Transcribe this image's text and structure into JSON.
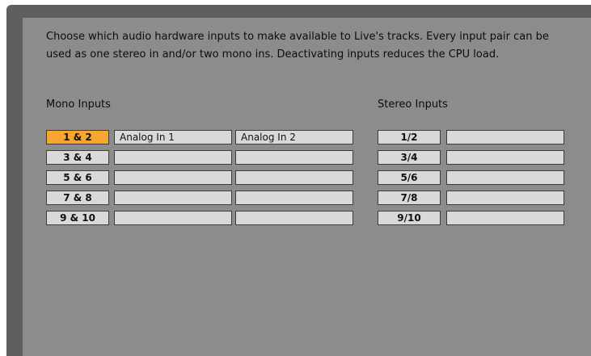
{
  "description": "Choose which audio hardware inputs to make available to Live's tracks. Every input pair can be used as one stereo in and/or two mono ins.  Deactivating inputs reduces the CPU load.",
  "mono": {
    "title": "Mono Inputs",
    "rows": [
      {
        "label": "1 & 2",
        "active": true,
        "name_a": "Analog In 1",
        "name_b": "Analog In 2"
      },
      {
        "label": "3 & 4",
        "active": false,
        "name_a": "",
        "name_b": ""
      },
      {
        "label": "5 & 6",
        "active": false,
        "name_a": "",
        "name_b": ""
      },
      {
        "label": "7 & 8",
        "active": false,
        "name_a": "",
        "name_b": ""
      },
      {
        "label": "9 & 10",
        "active": false,
        "name_a": "",
        "name_b": ""
      }
    ]
  },
  "stereo": {
    "title": "Stereo Inputs",
    "rows": [
      {
        "label": "1/2",
        "active": false,
        "name": ""
      },
      {
        "label": "3/4",
        "active": false,
        "name": ""
      },
      {
        "label": "5/6",
        "active": false,
        "name": ""
      },
      {
        "label": "7/8",
        "active": false,
        "name": ""
      },
      {
        "label": "9/10",
        "active": false,
        "name": ""
      }
    ]
  },
  "colors": {
    "active": "#f8a630",
    "inactive": "#d9d9d9",
    "panel": "#8c8c8c"
  }
}
